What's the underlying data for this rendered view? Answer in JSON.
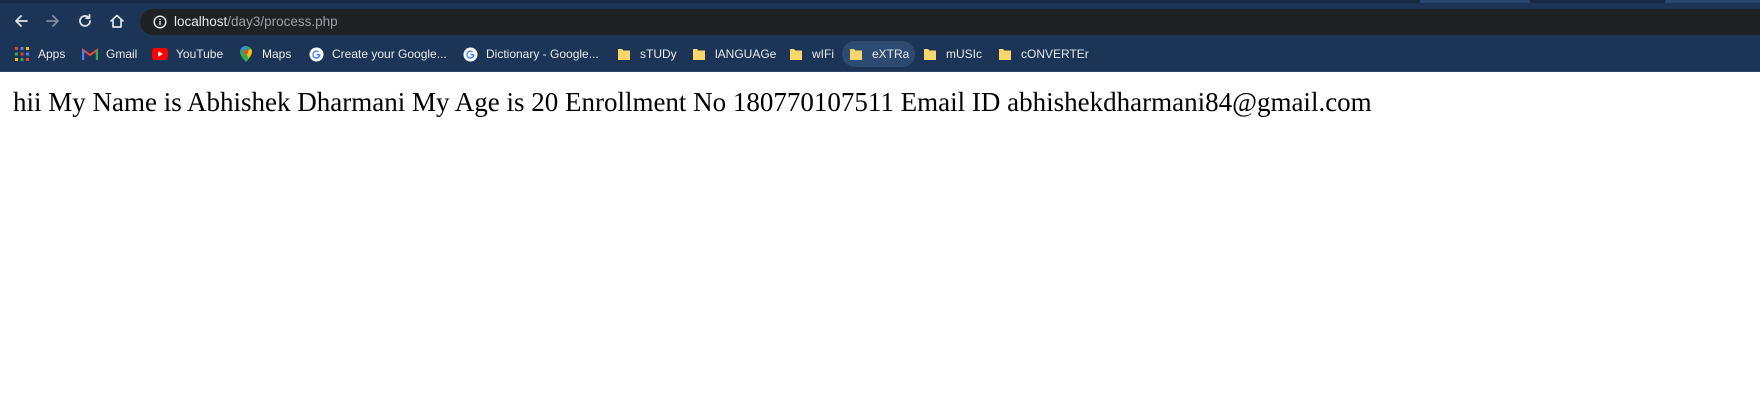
{
  "browser": {
    "address_bar": {
      "host": "localhost",
      "path": "/day3/process.php"
    },
    "bookmarks": [
      {
        "label": "Apps",
        "icon": "apps-grid-icon"
      },
      {
        "label": "Gmail",
        "icon": "gmail-icon"
      },
      {
        "label": "YouTube",
        "icon": "youtube-icon"
      },
      {
        "label": "Maps",
        "icon": "maps-pin-icon"
      },
      {
        "label": "Create your Google...",
        "icon": "google-icon"
      },
      {
        "label": "Dictionary - Google...",
        "icon": "google-icon"
      },
      {
        "label": "sTUDy",
        "icon": "folder-icon"
      },
      {
        "label": "lANGUAGe",
        "icon": "folder-icon"
      },
      {
        "label": "wIFi",
        "icon": "folder-icon"
      },
      {
        "label": "eXTRa",
        "icon": "folder-icon"
      },
      {
        "label": "mUSIc",
        "icon": "folder-icon"
      },
      {
        "label": "cONVERTEr",
        "icon": "folder-icon"
      }
    ],
    "colors": {
      "toolbar_bg": "#1c3556",
      "omnibox_bg": "#202124",
      "folder_yellow": "#f8d66c"
    }
  },
  "page": {
    "message": "hii My Name is Abhishek Dharmani My Age is 20 Enrollment No 180770107511 Email ID abhishekdharmani84@gmail.com"
  }
}
